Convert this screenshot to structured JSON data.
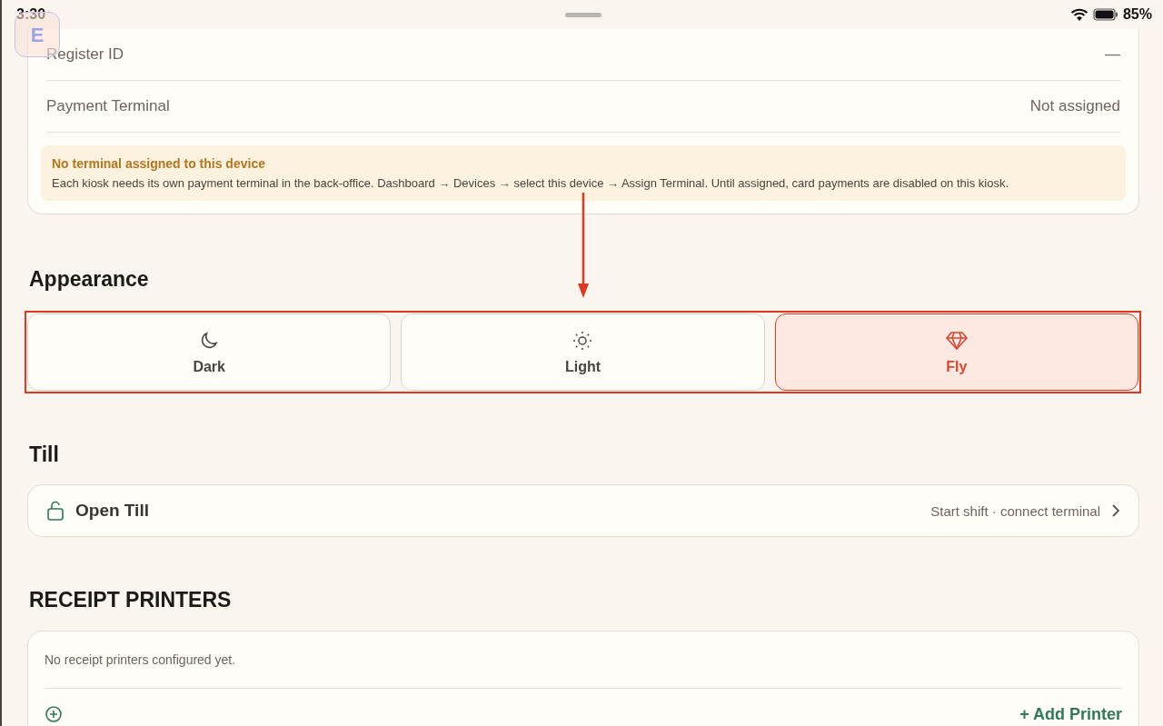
{
  "status_bar": {
    "time": "3:30",
    "battery": "85%"
  },
  "overlay_bubble": {
    "label": "E"
  },
  "device_card": {
    "rows": [
      {
        "label": "Register ID",
        "value": "—"
      },
      {
        "label": "Payment Terminal",
        "value": "Not assigned"
      }
    ],
    "alert": {
      "title": "No terminal assigned to this device",
      "text": "Each kiosk needs its own payment terminal in the back-office. Dashboard → Devices → select this device → Assign Terminal. Until assigned, card payments are disabled on this kiosk."
    }
  },
  "appearance": {
    "title": "Appearance",
    "options": [
      {
        "label": "Dark",
        "kind": "moon",
        "selected": false
      },
      {
        "label": "Light",
        "kind": "sun",
        "selected": false
      },
      {
        "label": "Fly",
        "kind": "gem",
        "selected": true
      }
    ]
  },
  "till": {
    "title": "Till",
    "item": {
      "label": "Open Till",
      "hint": "Start shift · connect terminal"
    }
  },
  "receipt_printers": {
    "title": "RECEIPT PRINTERS",
    "empty_text": "No receipt printers configured yet.",
    "add_label": "+ Add Printer"
  }
}
